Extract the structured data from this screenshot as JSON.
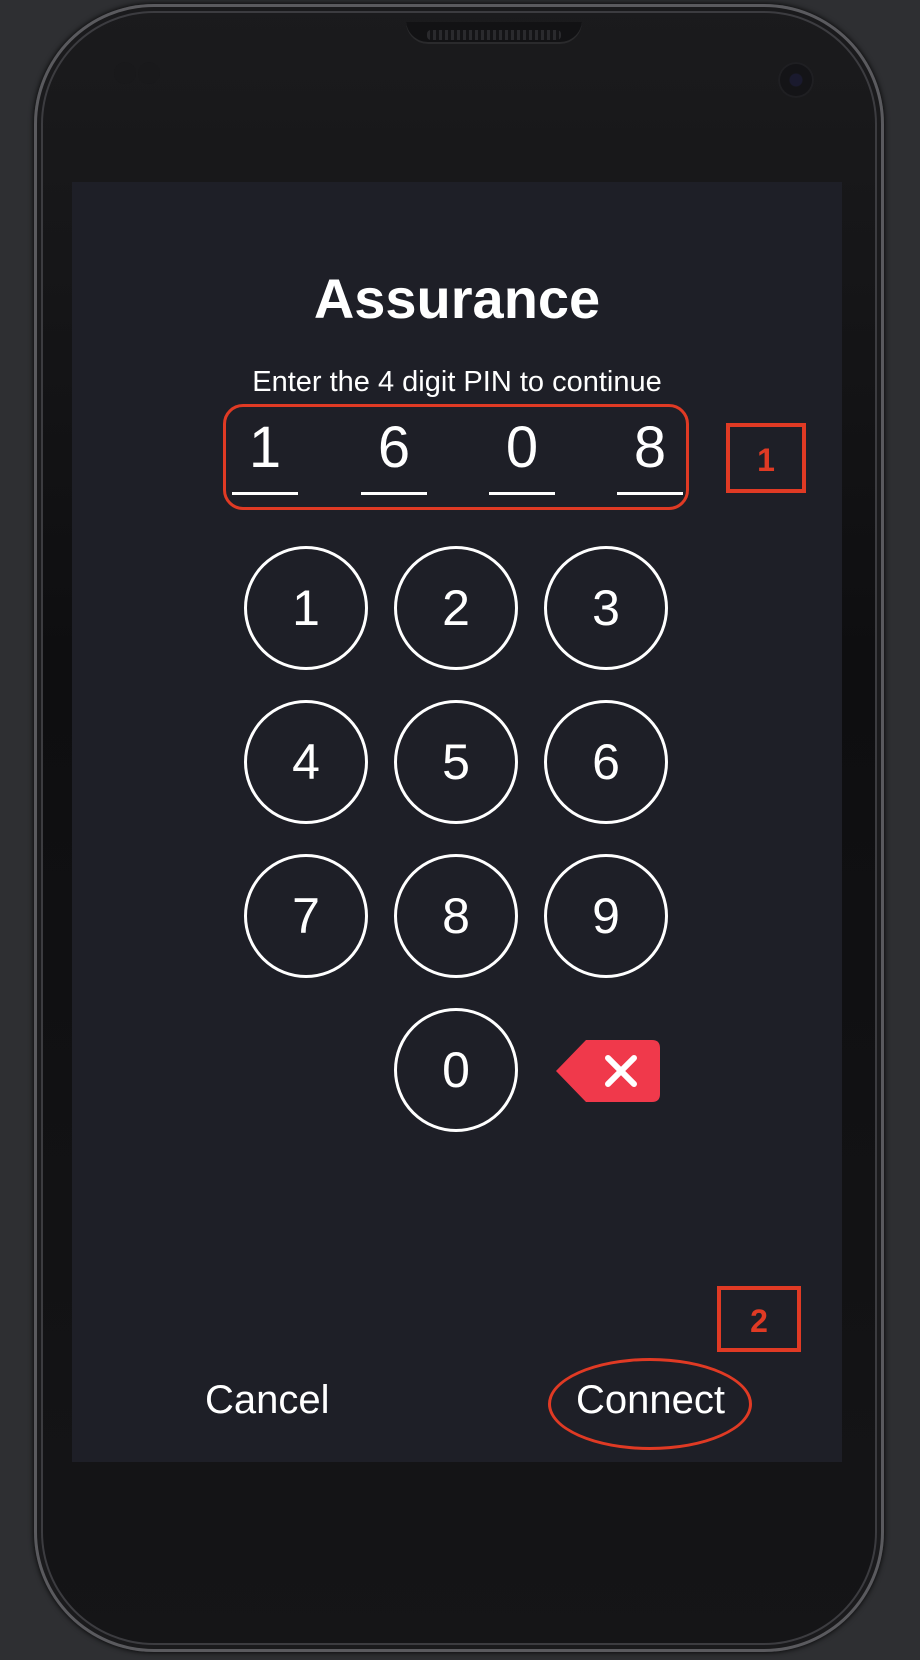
{
  "screen": {
    "title": "Assurance",
    "subtitle": "Enter the 4 digit PIN to continue"
  },
  "pin": {
    "digits": [
      "1",
      "6",
      "0",
      "8"
    ]
  },
  "keypad": {
    "keys": [
      "1",
      "2",
      "3",
      "4",
      "5",
      "6",
      "7",
      "8",
      "9",
      "0"
    ],
    "backspace_icon": "backspace-icon"
  },
  "actions": {
    "cancel_label": "Cancel",
    "connect_label": "Connect"
  },
  "annotations": {
    "marker_1": "1",
    "marker_2": "2"
  },
  "colors": {
    "screen_bg": "#1e1f27",
    "highlight": "#e03a24",
    "backspace": "#f0394b"
  }
}
